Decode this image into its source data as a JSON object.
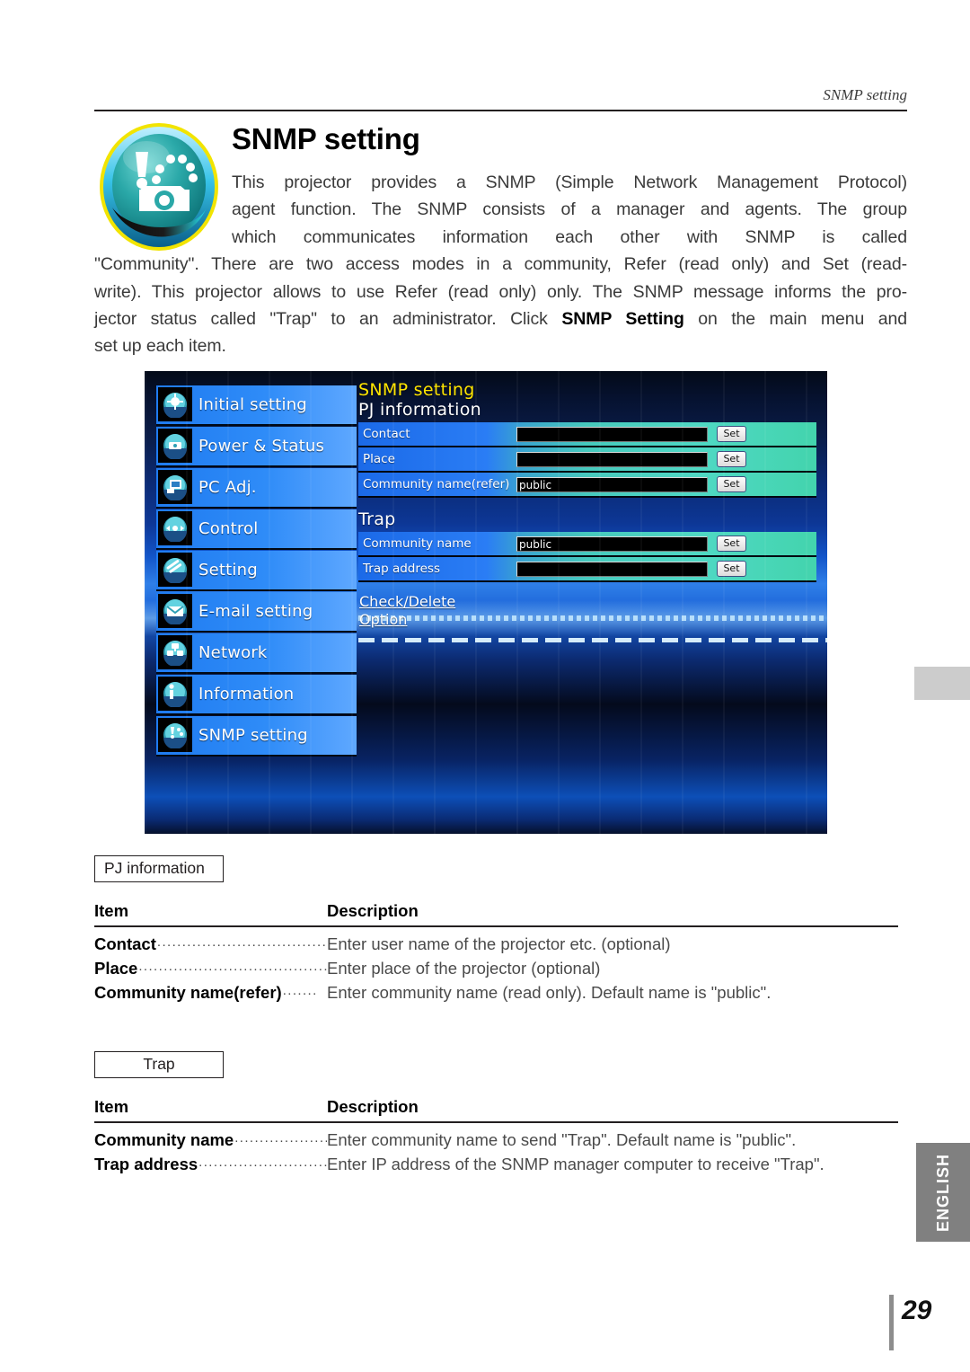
{
  "running_head": "SNMP setting",
  "page_title": "SNMP setting",
  "intro": {
    "line1": "This projector provides a SNMP (Simple Network Management Protocol)",
    "line2": "agent function. The SNMP consists of a manager and agents. The group",
    "line3": "which communicates information each other with SNMP is called",
    "line4": "\"Community\". There are two access modes in a community, Refer (read only) and Set (read-",
    "line5": "write). This projector allows to use Refer (read only) only. The SNMP message informs the pro-",
    "line6_a": "jector status called \"Trap\" to an administrator. Click ",
    "line6_bold": "SNMP Setting",
    "line6_b": " on the main menu and",
    "line7": "set up each item."
  },
  "screenshot": {
    "menu": [
      {
        "label": "Initial setting",
        "icon": "initial-setting-icon"
      },
      {
        "label": "Power & Status",
        "icon": "power-status-icon"
      },
      {
        "label": "PC Adj.",
        "icon": "pc-adj-icon"
      },
      {
        "label": "Control",
        "icon": "control-icon"
      },
      {
        "label": "Setting",
        "icon": "setting-icon"
      },
      {
        "label": "E-mail setting",
        "icon": "email-setting-icon"
      },
      {
        "label": "Network",
        "icon": "network-icon"
      },
      {
        "label": "Information",
        "icon": "information-icon"
      },
      {
        "label": "SNMP setting",
        "icon": "snmp-setting-icon"
      }
    ],
    "pane_title": "SNMP setting",
    "pj_information": {
      "heading": "PJ information",
      "rows": [
        {
          "label": "Contact",
          "value": "",
          "button": "Set"
        },
        {
          "label": "Place",
          "value": "",
          "button": "Set"
        },
        {
          "label": "Community name(refer)",
          "value": "public",
          "button": "Set"
        }
      ]
    },
    "trap": {
      "heading": "Trap",
      "rows": [
        {
          "label": "Community name",
          "value": "public",
          "button": "Set"
        },
        {
          "label": "Trap address",
          "value": "",
          "button": "Set"
        }
      ]
    },
    "links": [
      {
        "label": "Check/Delete"
      },
      {
        "label": "Option"
      }
    ]
  },
  "tables": [
    {
      "boxed_label": "PJ information",
      "headers": {
        "item": "Item",
        "description": "Description"
      },
      "rows": [
        {
          "item": "Contact",
          "leader": "...........................................",
          "description": "Enter user name of the projector etc. (optional)"
        },
        {
          "item": "Place",
          "leader": ".................................................",
          "description": "Enter place of the projector (optional)"
        },
        {
          "item": "Community name(refer)",
          "leader": ".......",
          "description": "Enter community name (read only). Default name is \"public\"."
        }
      ]
    },
    {
      "boxed_label": "Trap",
      "headers": {
        "item": "Item",
        "description": "Description"
      },
      "rows": [
        {
          "item": "Community name",
          "leader": "....................",
          "description": "Enter community name to send \"Trap\". Default name is \"public\"."
        },
        {
          "item": "Trap address",
          "leader": "................................",
          "description": "Enter IP address of the SNMP manager computer to receive \"Trap\"."
        }
      ]
    }
  ],
  "language_tab": "ENGLISH",
  "page_number": "29",
  "colors": {
    "accent_yellow": "#ffe500",
    "menu_blue": "#2f8cf8",
    "row_teal": "#4fd8c4",
    "lang_tab_gray": "#808080",
    "marker_gray": "#cccccc"
  }
}
